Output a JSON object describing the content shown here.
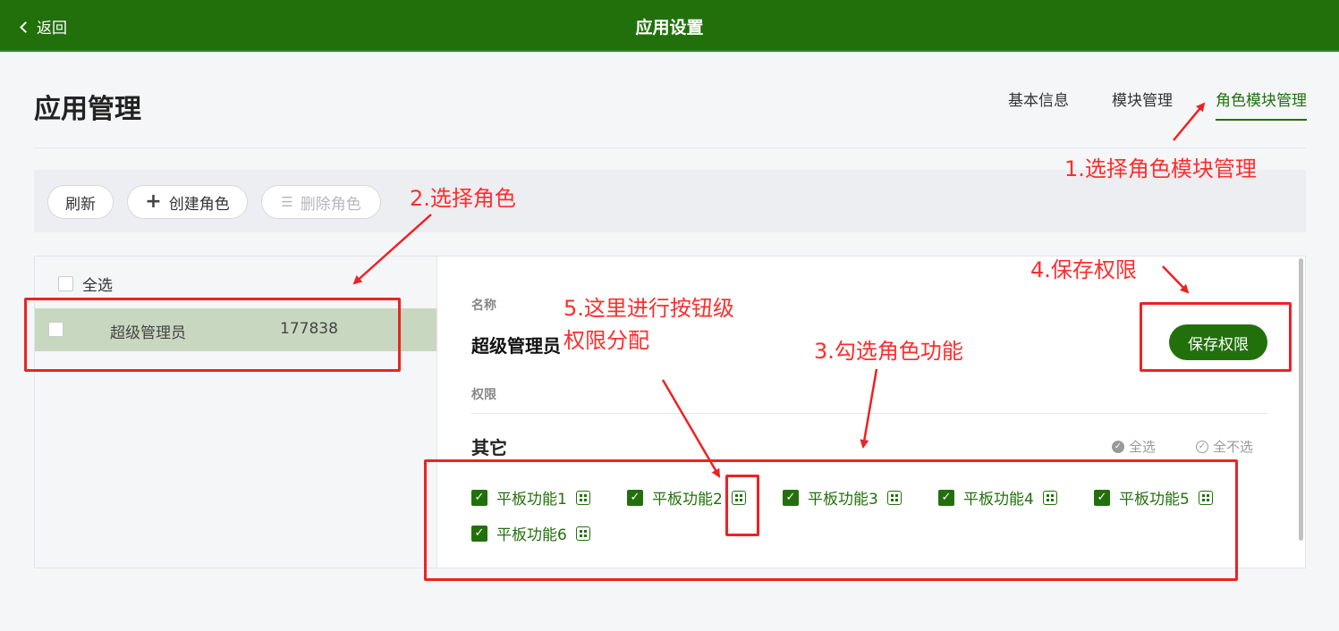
{
  "topbar": {
    "back_label": "返回",
    "title": "应用设置"
  },
  "page": {
    "title": "应用管理"
  },
  "tabs": [
    {
      "label": "基本信息",
      "active": false
    },
    {
      "label": "模块管理",
      "active": false
    },
    {
      "label": "角色模块管理",
      "active": true
    }
  ],
  "toolbar": {
    "refresh": "刷新",
    "create_role": "创建角色",
    "delete_role": "删除角色"
  },
  "roles": {
    "select_all": "全选",
    "items": [
      {
        "name": "超级管理员",
        "id": "177838",
        "selected": true
      }
    ]
  },
  "detail": {
    "name_label": "名称",
    "name_value": "超级管理员",
    "save_label": "保存权限",
    "perm_label": "权限",
    "group_title": "其它",
    "select_all": "全选",
    "select_none": "全不选",
    "functions": [
      {
        "label": "平板功能1",
        "checked": true
      },
      {
        "label": "平板功能2",
        "checked": true
      },
      {
        "label": "平板功能3",
        "checked": true
      },
      {
        "label": "平板功能4",
        "checked": true
      },
      {
        "label": "平板功能5",
        "checked": true
      },
      {
        "label": "平板功能6",
        "checked": true
      }
    ]
  },
  "annotations": {
    "step1": "1.选择角色模块管理",
    "step2": "2.选择角色",
    "step3": "3.勾选角色功能",
    "step4": "4.保存权限",
    "step5_line1": "5.这里进行按钮级",
    "step5_line2": "权限分配"
  },
  "colors": {
    "brand": "#22700c",
    "annotation": "#ff2d2d",
    "selected_row": "#c8d8c0"
  }
}
